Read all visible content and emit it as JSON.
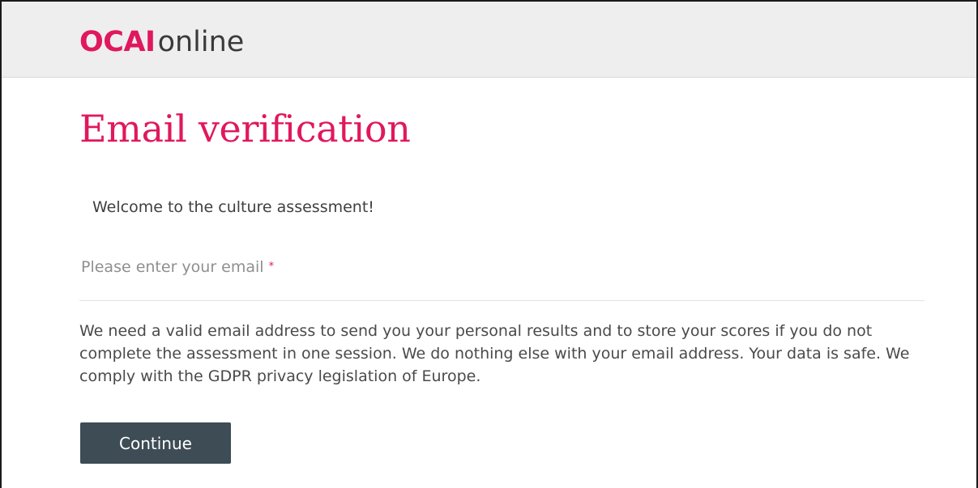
{
  "header": {
    "logo_bold": "OCAI",
    "logo_light": "online"
  },
  "page": {
    "title": "Email verification",
    "welcome": "Welcome to the culture assessment!"
  },
  "form": {
    "email_label": "Please enter your email",
    "required_mark": "*",
    "email_value": "",
    "info_text": "We need a valid email address to send you your personal results and to store your scores if you do not complete the assessment in one session. We do nothing else with your email address. Your data is safe. We comply with the GDPR privacy legislation of Europe.",
    "continue_label": "Continue"
  },
  "colors": {
    "brand": "#e0185d",
    "button": "#3d4c55",
    "header_bg": "#eeeeef"
  }
}
